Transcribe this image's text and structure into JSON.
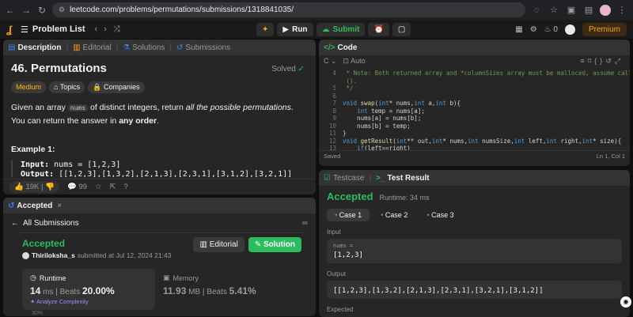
{
  "browser": {
    "url": "leetcode.com/problems/permutations/submissions/1318841035/"
  },
  "navbar": {
    "problem_list": "Problem List",
    "run": "Run",
    "submit": "Submit",
    "streak": "0",
    "premium": "Premium"
  },
  "description_panel": {
    "tabs": [
      "Description",
      "Editorial",
      "Solutions",
      "Submissions"
    ],
    "title": "46. Permutations",
    "status": "Solved",
    "difficulty": "Medium",
    "topics": "Topics",
    "companies": "Companies",
    "statement_prefix": "Given an array",
    "statement_code": "nums",
    "statement_mid": "of distinct integers, return",
    "statement_em": "all the possible permutations",
    "statement_mid2": ". You can return the answer in",
    "statement_bold": "any order",
    "statement_end": ".",
    "example_title": "Example 1:",
    "input_label": "Input:",
    "input_value": "nums = [1,2,3]",
    "output_label": "Output:",
    "output_value": "[[1,2,3],[1,3,2],[2,1,3],[2,3,1],[3,1,2],[3,2,1]]",
    "likes": "19K",
    "comments": "99"
  },
  "accepted_panel": {
    "tab": "Accepted",
    "back": "All Submissions",
    "status": "Accepted",
    "user": "Thiriloksha_s",
    "submitted": "submitted at Jul 12, 2024 21:43",
    "editorial": "Editorial",
    "solution": "Solution",
    "runtime_label": "Runtime",
    "runtime_value": "14",
    "runtime_unit": "ms",
    "beats_label": "Beats",
    "runtime_beats": "20.00%",
    "analyze": "Analyze Complexity",
    "memory_label": "Memory",
    "memory_value": "11.93",
    "memory_unit": "MB",
    "memory_beats": "5.41%",
    "axis_label": "30%"
  },
  "code_panel": {
    "tab": "Code",
    "language": "Auto",
    "status_left": "Saved",
    "status_right": "Ln 1, Col 1",
    "lines": [
      {
        "n": "4",
        "t": " * Note: Both returned array and *columnSizes array must be malloced, assume caller calls free",
        "c": "cm"
      },
      {
        "n": "",
        "t": " ().",
        "c": "cm"
      },
      {
        "n": "5",
        "t": " */",
        "c": "cm"
      },
      {
        "n": "6",
        "t": "",
        "c": ""
      },
      {
        "n": "7",
        "t": "void swap(int* nums,int a,int b){",
        "c": ""
      },
      {
        "n": "8",
        "t": "    int temp = nums[a];",
        "c": ""
      },
      {
        "n": "9",
        "t": "    nums[a] = nums[b];",
        "c": ""
      },
      {
        "n": "10",
        "t": "    nums[b] = temp;",
        "c": ""
      },
      {
        "n": "11",
        "t": "}",
        "c": ""
      },
      {
        "n": "12",
        "t": "void getResult(int** out,int* nums,int numsSize,int left,int right,int* size){",
        "c": ""
      },
      {
        "n": "13",
        "t": "    if(left==right)",
        "c": ""
      }
    ]
  },
  "test_panel": {
    "tab_testcase": "Testcase",
    "tab_result": "Test Result",
    "status": "Accepted",
    "runtime": "Runtime: 34 ms",
    "cases": [
      "Case 1",
      "Case 2",
      "Case 3"
    ],
    "input_label": "Input",
    "input_var": "nums =",
    "input_value": "[1,2,3]",
    "output_label": "Output",
    "output_value": "[[1,2,3],[1,3,2],[2,1,3],[2,3,1],[3,2,1],[3,1,2]]",
    "expected_label": "Expected"
  },
  "colors": {
    "accent_green": "#2cbb5d",
    "brand_orange": "#ffa116",
    "medium": "#ffb800"
  }
}
